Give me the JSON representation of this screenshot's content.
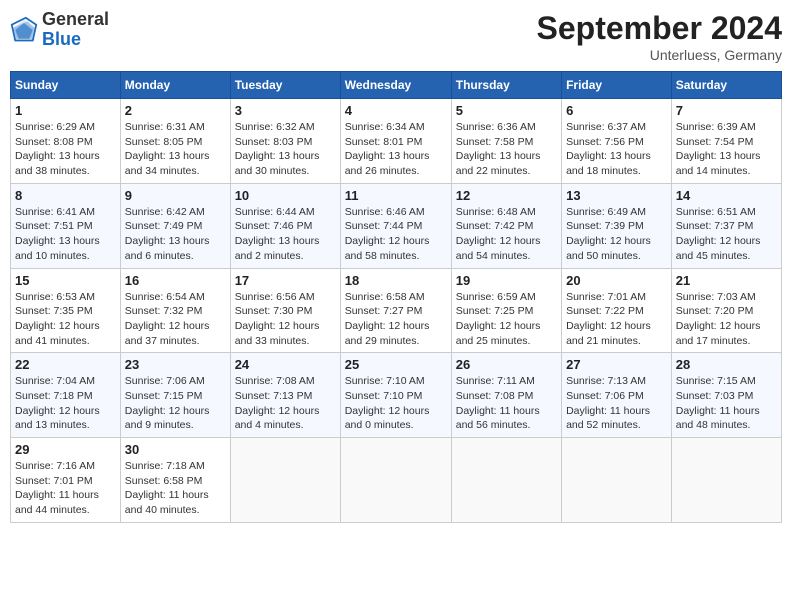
{
  "header": {
    "logo_general": "General",
    "logo_blue": "Blue",
    "month_title": "September 2024",
    "subtitle": "Unterluess, Germany"
  },
  "days_of_week": [
    "Sunday",
    "Monday",
    "Tuesday",
    "Wednesday",
    "Thursday",
    "Friday",
    "Saturday"
  ],
  "weeks": [
    [
      {
        "day": "1",
        "detail": "Sunrise: 6:29 AM\nSunset: 8:08 PM\nDaylight: 13 hours\nand 38 minutes."
      },
      {
        "day": "2",
        "detail": "Sunrise: 6:31 AM\nSunset: 8:05 PM\nDaylight: 13 hours\nand 34 minutes."
      },
      {
        "day": "3",
        "detail": "Sunrise: 6:32 AM\nSunset: 8:03 PM\nDaylight: 13 hours\nand 30 minutes."
      },
      {
        "day": "4",
        "detail": "Sunrise: 6:34 AM\nSunset: 8:01 PM\nDaylight: 13 hours\nand 26 minutes."
      },
      {
        "day": "5",
        "detail": "Sunrise: 6:36 AM\nSunset: 7:58 PM\nDaylight: 13 hours\nand 22 minutes."
      },
      {
        "day": "6",
        "detail": "Sunrise: 6:37 AM\nSunset: 7:56 PM\nDaylight: 13 hours\nand 18 minutes."
      },
      {
        "day": "7",
        "detail": "Sunrise: 6:39 AM\nSunset: 7:54 PM\nDaylight: 13 hours\nand 14 minutes."
      }
    ],
    [
      {
        "day": "8",
        "detail": "Sunrise: 6:41 AM\nSunset: 7:51 PM\nDaylight: 13 hours\nand 10 minutes."
      },
      {
        "day": "9",
        "detail": "Sunrise: 6:42 AM\nSunset: 7:49 PM\nDaylight: 13 hours\nand 6 minutes."
      },
      {
        "day": "10",
        "detail": "Sunrise: 6:44 AM\nSunset: 7:46 PM\nDaylight: 13 hours\nand 2 minutes."
      },
      {
        "day": "11",
        "detail": "Sunrise: 6:46 AM\nSunset: 7:44 PM\nDaylight: 12 hours\nand 58 minutes."
      },
      {
        "day": "12",
        "detail": "Sunrise: 6:48 AM\nSunset: 7:42 PM\nDaylight: 12 hours\nand 54 minutes."
      },
      {
        "day": "13",
        "detail": "Sunrise: 6:49 AM\nSunset: 7:39 PM\nDaylight: 12 hours\nand 50 minutes."
      },
      {
        "day": "14",
        "detail": "Sunrise: 6:51 AM\nSunset: 7:37 PM\nDaylight: 12 hours\nand 45 minutes."
      }
    ],
    [
      {
        "day": "15",
        "detail": "Sunrise: 6:53 AM\nSunset: 7:35 PM\nDaylight: 12 hours\nand 41 minutes."
      },
      {
        "day": "16",
        "detail": "Sunrise: 6:54 AM\nSunset: 7:32 PM\nDaylight: 12 hours\nand 37 minutes."
      },
      {
        "day": "17",
        "detail": "Sunrise: 6:56 AM\nSunset: 7:30 PM\nDaylight: 12 hours\nand 33 minutes."
      },
      {
        "day": "18",
        "detail": "Sunrise: 6:58 AM\nSunset: 7:27 PM\nDaylight: 12 hours\nand 29 minutes."
      },
      {
        "day": "19",
        "detail": "Sunrise: 6:59 AM\nSunset: 7:25 PM\nDaylight: 12 hours\nand 25 minutes."
      },
      {
        "day": "20",
        "detail": "Sunrise: 7:01 AM\nSunset: 7:22 PM\nDaylight: 12 hours\nand 21 minutes."
      },
      {
        "day": "21",
        "detail": "Sunrise: 7:03 AM\nSunset: 7:20 PM\nDaylight: 12 hours\nand 17 minutes."
      }
    ],
    [
      {
        "day": "22",
        "detail": "Sunrise: 7:04 AM\nSunset: 7:18 PM\nDaylight: 12 hours\nand 13 minutes."
      },
      {
        "day": "23",
        "detail": "Sunrise: 7:06 AM\nSunset: 7:15 PM\nDaylight: 12 hours\nand 9 minutes."
      },
      {
        "day": "24",
        "detail": "Sunrise: 7:08 AM\nSunset: 7:13 PM\nDaylight: 12 hours\nand 4 minutes."
      },
      {
        "day": "25",
        "detail": "Sunrise: 7:10 AM\nSunset: 7:10 PM\nDaylight: 12 hours\nand 0 minutes."
      },
      {
        "day": "26",
        "detail": "Sunrise: 7:11 AM\nSunset: 7:08 PM\nDaylight: 11 hours\nand 56 minutes."
      },
      {
        "day": "27",
        "detail": "Sunrise: 7:13 AM\nSunset: 7:06 PM\nDaylight: 11 hours\nand 52 minutes."
      },
      {
        "day": "28",
        "detail": "Sunrise: 7:15 AM\nSunset: 7:03 PM\nDaylight: 11 hours\nand 48 minutes."
      }
    ],
    [
      {
        "day": "29",
        "detail": "Sunrise: 7:16 AM\nSunset: 7:01 PM\nDaylight: 11 hours\nand 44 minutes."
      },
      {
        "day": "30",
        "detail": "Sunrise: 7:18 AM\nSunset: 6:58 PM\nDaylight: 11 hours\nand 40 minutes."
      },
      {
        "day": "",
        "detail": ""
      },
      {
        "day": "",
        "detail": ""
      },
      {
        "day": "",
        "detail": ""
      },
      {
        "day": "",
        "detail": ""
      },
      {
        "day": "",
        "detail": ""
      }
    ]
  ]
}
